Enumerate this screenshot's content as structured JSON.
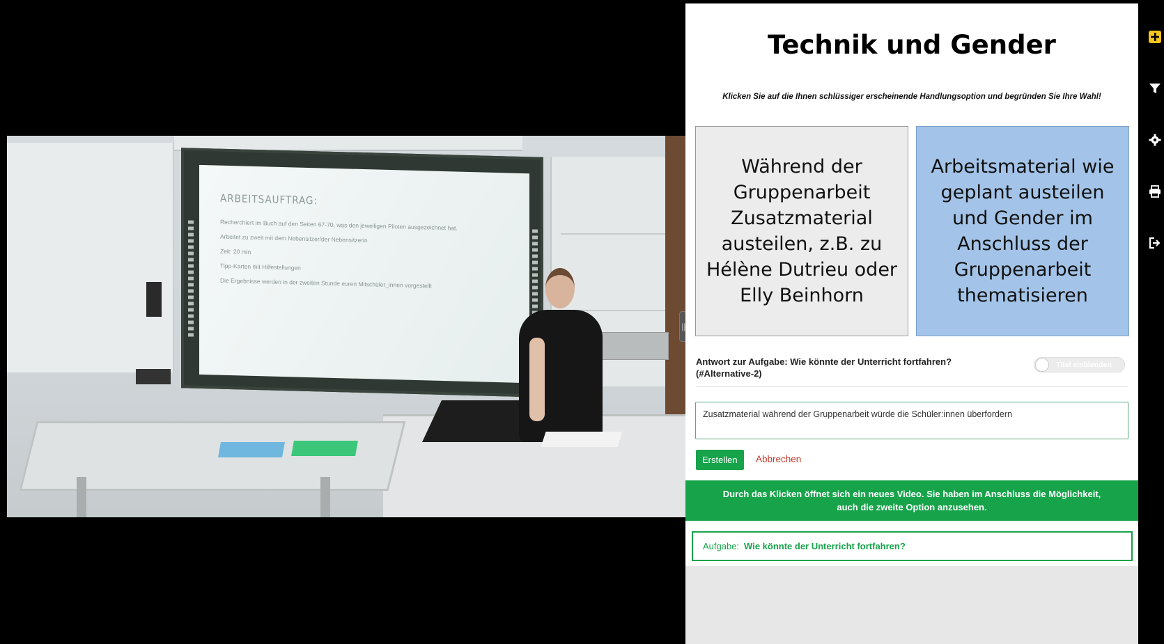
{
  "header": {
    "title": "Technik und Gender",
    "instruction": "Klicken Sie auf die Ihnen schlüssiger erscheinende Handlungsoption und begründen Sie Ihre Wahl!"
  },
  "options": [
    {
      "label": "Während der Gruppenarbeit Zusatzmaterial austeilen, z.B. zu Hélène Dutrieu oder Elly Beinhorn"
    },
    {
      "label": "Arbeitsmaterial wie geplant austeilen und Gender im Anschluss der Gruppenarbeit thematisieren"
    }
  ],
  "answer": {
    "title": "Antwort zur Aufgabe: Wie könnte der Unterricht fortfahren? (#Alternative-2)",
    "toggle_label": "Titel einblenden",
    "input_value": "Zusatzmaterial während der Gruppenarbeit würde die Schüler:innen überfordern",
    "create_label": "Erstellen",
    "cancel_label": "Abbrechen"
  },
  "banner": {
    "text_line1": "Durch das Klicken öffnet sich ein neues Video. Sie haben im Anschluss die Möglichkeit,",
    "text_line2": "auch die zweite Option anzusehen."
  },
  "task": {
    "label": "Aufgabe:",
    "text": "Wie könnte der Unterricht fortfahren?"
  },
  "video": {
    "board_heading": "ARBEITSAUFTRAG:",
    "board_lines": [
      "Recherchiert im Buch auf den Seiten 67-70, was den jeweiligen Piloten ausgezeichnet hat.",
      "Arbeitet zu zweit mit dem Nebensitzer/der Nebensitzerin",
      "Zeit: 20 min",
      "Tipp-Karten mit Hilfestellungen",
      "Die Ergebnisse werden in der zweiten Stunde euren Mitschüler_innen vorgestellt"
    ]
  },
  "toolbar": {
    "icons": [
      "add-icon",
      "filter-icon",
      "settings-icon",
      "print-icon",
      "logout-icon"
    ],
    "accent_color": "#f5c518"
  },
  "colors": {
    "accent_green": "#16a34a",
    "selected_option": "#a3c4e8"
  }
}
